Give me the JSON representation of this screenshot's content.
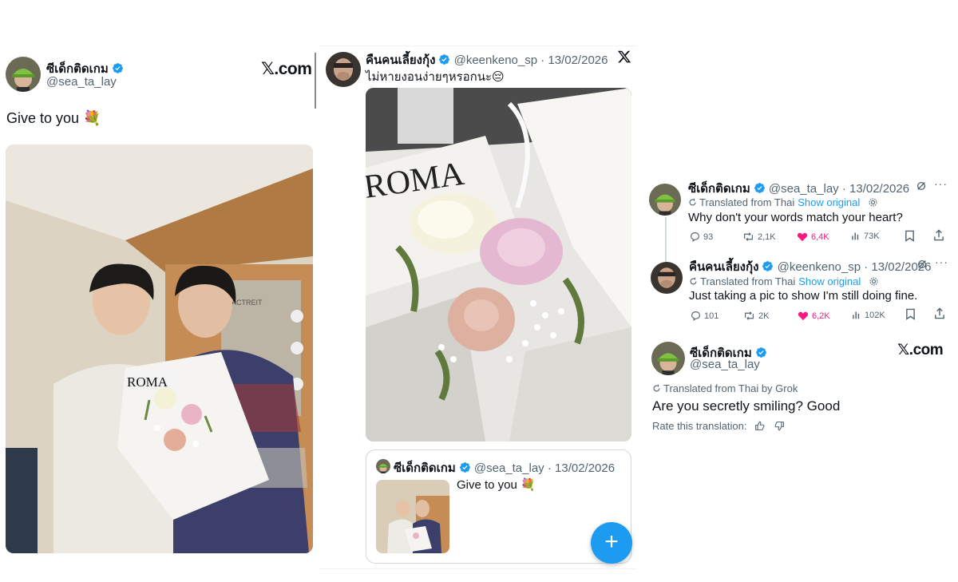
{
  "left_tweet": {
    "display_name": "ซีเด็กติดเกม",
    "handle": "@sea_ta_lay",
    "brand": "𝕏.com",
    "text": "Give to you 💐",
    "photo_sign_text": "ROMA",
    "photo_wall_text": "ACTREIT"
  },
  "middle_tweet": {
    "display_name": "คืนคนเลี้ยงกุ้ง",
    "handle": "@keenkeno_sp",
    "date": "· 13/02/2026",
    "text": "ไม่หายงอนง่ายๆหรอกนะ😔",
    "photo_sign_text": "ROMA",
    "quote": {
      "display_name": "ซีเด็กติดเกม",
      "handle": "@sea_ta_lay",
      "date": "· 13/02/2026",
      "text": "Give to you 💐"
    },
    "fab_label": "+"
  },
  "right_thread": {
    "reply1": {
      "display_name": "ซีเด็กติดเกม",
      "handle": "@sea_ta_lay",
      "date": "· 13/02/2026",
      "translated": "Translated from Thai",
      "show_original": "Show original",
      "text": "Why don't your words match your heart?",
      "replies": "93",
      "reposts": "2,1K",
      "likes": "6,4K",
      "views": "73K"
    },
    "reply2": {
      "display_name": "คืนคนเลี้ยงกุ้ง",
      "handle": "@keenkeno_sp",
      "date": "· 13/02/2026",
      "translated": "Translated from Thai",
      "show_original": "Show original",
      "text": "Just taking a pic to show I'm still doing fine.",
      "replies": "101",
      "reposts": "2K",
      "likes": "6,2K",
      "views": "102K"
    },
    "reply3": {
      "display_name": "ซีเด็กติดเกม",
      "handle": "@sea_ta_lay",
      "brand": "𝕏.com",
      "translated": "Translated from Thai by Grok",
      "text": "Are you secretly smiling? Good",
      "rate": "Rate this translation:"
    }
  },
  "colors": {
    "accent": "#1d9bf0",
    "like": "#f91880",
    "secondary_text": "#536471",
    "border": "#cfd9de"
  },
  "icons": [
    "verified-badge-icon",
    "x-logo-icon",
    "reply-icon",
    "repost-icon",
    "like-icon",
    "views-icon",
    "bookmark-icon",
    "share-icon",
    "grok-icon",
    "more-icon",
    "translate-icon",
    "settings-icon",
    "thumbs-up-icon",
    "thumbs-down-icon",
    "plus-icon"
  ]
}
